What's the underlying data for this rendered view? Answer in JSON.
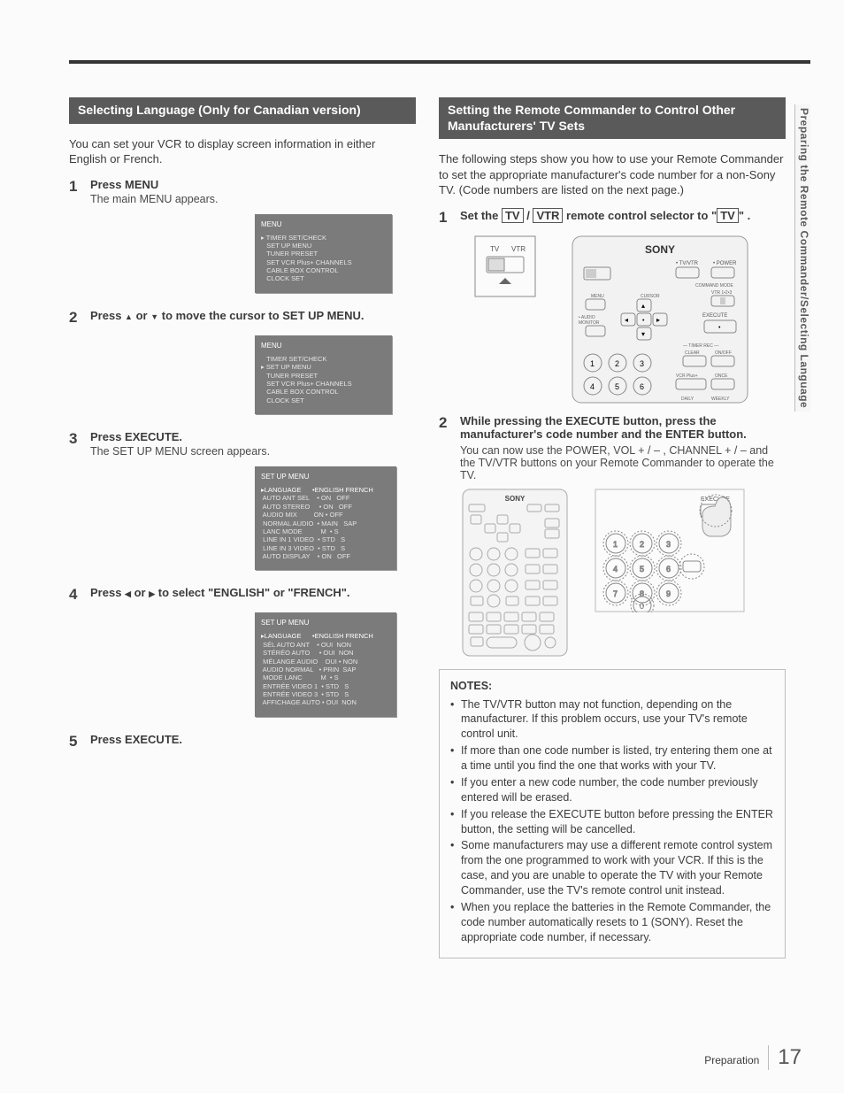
{
  "side_tab": "Preparing the Remote Commander/Selecting Language",
  "footer": {
    "section": "Preparation",
    "page": "17"
  },
  "left": {
    "header": "Selecting Language (Only for Canadian version)",
    "intro": "You can set your VCR to display screen information in either English or French.",
    "steps": [
      {
        "num": "1",
        "title": "Press MENU",
        "sub": "The main MENU appears.",
        "screen": {
          "title": "MENU",
          "lines": [
            "▸ TIMER SET/CHECK",
            "   SET UP MENU",
            "   TUNER PRESET",
            "   SET VCR Plus+ CHANNELS",
            "   CABLE BOX CONTROL",
            "   CLOCK SET"
          ]
        }
      },
      {
        "num": "2",
        "title_parts": [
          "Press ",
          "▲",
          " or ",
          "▼",
          " to move the cursor to SET UP MENU."
        ],
        "screen": {
          "title": "MENU",
          "lines": [
            "   TIMER SET/CHECK",
            "▸ SET UP MENU",
            "   TUNER PRESET",
            "   SET VCR Plus+ CHANNELS",
            "   CABLE BOX CONTROL",
            "   CLOCK SET"
          ]
        }
      },
      {
        "num": "3",
        "title": "Press EXECUTE.",
        "sub": "The SET UP MENU screen appears.",
        "screen": {
          "title": "SET UP MENU",
          "header_row": "▸LANGUAGE      •ENGLISH FRENCH",
          "lines": [
            " AUTO ANT SEL    • ON   OFF",
            " AUTO STEREO     • ON   OFF",
            " AUDIO MIX         ON • OFF",
            " NORMAL AUDIO  • MAIN   SAP",
            " LANC MODE          M  • S",
            " LINE IN 1 VIDEO  • STD   S",
            " LINE IN 3 VIDEO  • STD   S",
            " AUTO DISPLAY    • ON   OFF"
          ]
        }
      },
      {
        "num": "4",
        "title_parts": [
          "Press ",
          "◀",
          " or ",
          "▶",
          " to select \"ENGLISH\" or \"FRENCH\"."
        ],
        "screen": {
          "title": "SET UP MENU",
          "header_row": "▸LANGUAGE      •ENGLISH FRENCH",
          "lines": [
            " SÉL AUTO ANT    • OUI  NON",
            " STÉRÉO AUTO     • OUI  NON",
            " MÉLANGE AUDIO    OUI • NON",
            " AUDIO NORMAL   • PRIN  SAP",
            " MODE LANC          M  • S",
            " ENTRÉE VIDEO 1  • STD   S",
            " ENTRÉE VIDEO 3  • STD   S",
            " AFFICHAGE AUTO • OUI  NON"
          ]
        }
      },
      {
        "num": "5",
        "title": "Press EXECUTE."
      }
    ]
  },
  "right": {
    "header": "Setting the Remote Commander to Control Other Manufacturers' TV Sets",
    "intro": "The following steps show you how to use your Remote Commander to set the appropriate manufacturer's code number for a non-Sony TV. (Code numbers are listed on the next page.)",
    "step1_parts": [
      "Set the ",
      "TV",
      " / ",
      "VTR",
      " remote control selector to \"",
      "TV",
      "\" ."
    ],
    "detail_labels": {
      "tv": "TV",
      "vtr": "VTR"
    },
    "remote_brand": "SONY",
    "remote_labels": {
      "tvvtr": "• TV/VTR",
      "power": "• POWER",
      "command_mode": "COMMAND MODE",
      "vtr123": "VTR 1•2•3",
      "menu": "MENU",
      "audio_monitor": "• AUDIO MONITOR",
      "cursor": "CURSOR",
      "execute": "EXECUTE",
      "timer_rec": "— TIMER REC —",
      "clear": "CLEAR",
      "onoff": "ON/OFF",
      "vcrplus": "VCR Plus+",
      "once": "ONCE",
      "daily": "DAILY",
      "weekly": "WEEKLY"
    },
    "step2": {
      "num": "2",
      "title": "While pressing the EXECUTE button, press the manufacturer's code number and the ENTER button.",
      "sub": "You can now use the POWER, VOL + / – , CHANNEL + / – and the TV/VTR buttons on your Remote Commander to operate the TV."
    },
    "notes_title": "NOTES:",
    "notes": [
      "The TV/VTR button may not function, depending on the manufacturer. If this problem occurs, use your TV's remote control unit.",
      "If more than one code number is listed, try entering them one at a time until you find the one that works with your TV.",
      "If you enter a new code number, the code number previously entered will be erased.",
      "If you release the EXECUTE button before pressing the ENTER button, the setting will be cancelled.",
      "Some manufacturers may use a different remote control system from the one programmed to work with your VCR. If this is the case, and you are unable to operate the TV with your Remote Commander, use the TV's remote control unit instead.",
      "When you replace the batteries in the Remote Commander, the code number automatically resets to 1 (SONY). Reset the appropriate code number, if necessary."
    ]
  }
}
